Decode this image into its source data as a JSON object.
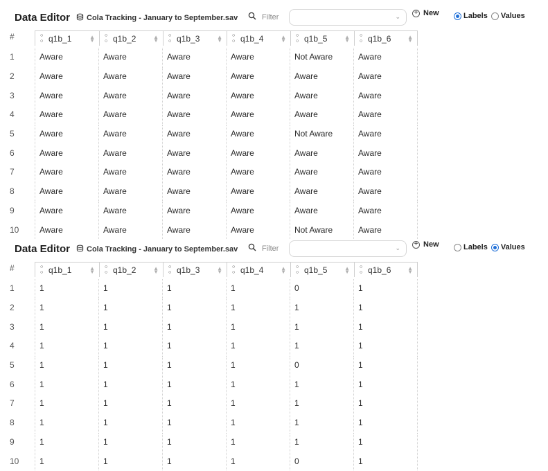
{
  "panels": [
    {
      "toolbar": {
        "title": "Data Editor",
        "file_icon": "database-icon",
        "file_name": "Cola Tracking - January to September.sav",
        "search_icon": "search-icon",
        "filter_label": "Filter",
        "filter_value": "",
        "new_label": "New",
        "labels_option": "Labels",
        "values_option": "Values",
        "selected_mode": "Labels"
      },
      "columns": [
        "#",
        "q1b_1",
        "q1b_2",
        "q1b_3",
        "q1b_4",
        "q1b_5",
        "q1b_6"
      ],
      "column_icon": "nominal-variable-icon",
      "rows": [
        [
          "1",
          "Aware",
          "Aware",
          "Aware",
          "Aware",
          "Not Aware",
          "Aware"
        ],
        [
          "2",
          "Aware",
          "Aware",
          "Aware",
          "Aware",
          "Aware",
          "Aware"
        ],
        [
          "3",
          "Aware",
          "Aware",
          "Aware",
          "Aware",
          "Aware",
          "Aware"
        ],
        [
          "4",
          "Aware",
          "Aware",
          "Aware",
          "Aware",
          "Aware",
          "Aware"
        ],
        [
          "5",
          "Aware",
          "Aware",
          "Aware",
          "Aware",
          "Not Aware",
          "Aware"
        ],
        [
          "6",
          "Aware",
          "Aware",
          "Aware",
          "Aware",
          "Aware",
          "Aware"
        ],
        [
          "7",
          "Aware",
          "Aware",
          "Aware",
          "Aware",
          "Aware",
          "Aware"
        ],
        [
          "8",
          "Aware",
          "Aware",
          "Aware",
          "Aware",
          "Aware",
          "Aware"
        ],
        [
          "9",
          "Aware",
          "Aware",
          "Aware",
          "Aware",
          "Aware",
          "Aware"
        ],
        [
          "10",
          "Aware",
          "Aware",
          "Aware",
          "Aware",
          "Not Aware",
          "Aware"
        ]
      ]
    },
    {
      "toolbar": {
        "title": "Data Editor",
        "file_icon": "database-icon",
        "file_name": "Cola Tracking - January to September.sav",
        "search_icon": "search-icon",
        "filter_label": "Filter",
        "filter_value": "",
        "new_label": "New",
        "labels_option": "Labels",
        "values_option": "Values",
        "selected_mode": "Values"
      },
      "columns": [
        "#",
        "q1b_1",
        "q1b_2",
        "q1b_3",
        "q1b_4",
        "q1b_5",
        "q1b_6"
      ],
      "column_icon": "nominal-variable-icon",
      "rows": [
        [
          "1",
          "1",
          "1",
          "1",
          "1",
          "0",
          "1"
        ],
        [
          "2",
          "1",
          "1",
          "1",
          "1",
          "1",
          "1"
        ],
        [
          "3",
          "1",
          "1",
          "1",
          "1",
          "1",
          "1"
        ],
        [
          "4",
          "1",
          "1",
          "1",
          "1",
          "1",
          "1"
        ],
        [
          "5",
          "1",
          "1",
          "1",
          "1",
          "0",
          "1"
        ],
        [
          "6",
          "1",
          "1",
          "1",
          "1",
          "1",
          "1"
        ],
        [
          "7",
          "1",
          "1",
          "1",
          "1",
          "1",
          "1"
        ],
        [
          "8",
          "1",
          "1",
          "1",
          "1",
          "1",
          "1"
        ],
        [
          "9",
          "1",
          "1",
          "1",
          "1",
          "1",
          "1"
        ],
        [
          "10",
          "1",
          "1",
          "1",
          "1",
          "0",
          "1"
        ]
      ]
    }
  ],
  "colors": {
    "accent": "#1f6fd8",
    "grid_line": "#e2e2e2",
    "header_border": "#cfcfcf"
  }
}
